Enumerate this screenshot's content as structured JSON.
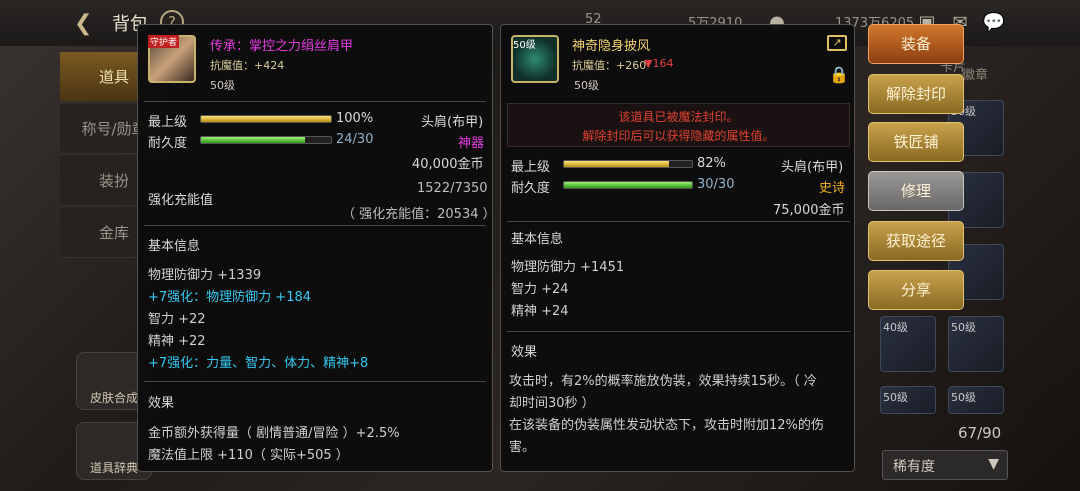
{
  "header": {
    "title": "背包",
    "currencies": [
      "52",
      "5万2910",
      "1373万6205"
    ]
  },
  "left_tabs": [
    "道具",
    "称号/勋章",
    "装扮",
    "金库"
  ],
  "left_buttons": [
    "皮肤合成",
    "道具辞典"
  ],
  "item1": {
    "badge": "守护者",
    "name": "传承：掌控之力绢丝肩甲",
    "resist": "抗魔值：+424",
    "level": "50级",
    "max_level_label": "最上级",
    "max_level_pct": "100%",
    "max_level_fill": 1.0,
    "durability_label": "耐久度",
    "durability": "24/30",
    "durability_fill": 0.8,
    "slot": "头肩(布甲)",
    "grade": "神器",
    "price": "40,000金币",
    "strength_label": "强化充能值",
    "strength_value": "1522/7350",
    "strength_sub": "（ 强化充能值：20534 ）",
    "basic_title": "基本信息",
    "stats": [
      "物理防御力 +1339",
      "+7强化：物理防御力 +184",
      "智力 +22",
      "精神 +22",
      "+7强化：力量、智力、体力、精神+8"
    ],
    "effect_title": "效果",
    "effects": [
      "金币额外获得量（ 剧情普通/冒险 ）+2.5%",
      "魔法值上限 +110（ 实际+505 ）"
    ]
  },
  "item2": {
    "icon_level": "50级",
    "name": "神奇隐身披风",
    "resist": "抗魔值：+260",
    "resist_down": "▼164",
    "level": "50级",
    "notice1": "该道具已被魔法封印。",
    "notice2": "解除封印后可以获得隐藏的属性值。",
    "max_level_label": "最上级",
    "max_level_pct": "82%",
    "max_level_fill": 0.82,
    "durability_label": "耐久度",
    "durability": "30/30",
    "durability_fill": 1.0,
    "slot": "头肩(布甲)",
    "grade": "史诗",
    "price": "75,000金币",
    "basic_title": "基本信息",
    "stats": [
      "物理防御力 +1451",
      "智力 +24",
      "精神 +24"
    ],
    "effect_title": "效果",
    "effect_lines": [
      "攻击时，有2%的概率施放伪装，效果持续15秒。（ 冷",
      "却时间30秒 ）",
      "在该装备的伪装属性发动状态下，攻击时附加12%的伤",
      "害。"
    ]
  },
  "actions": [
    "装备",
    "解除封印",
    "铁匠铺",
    "修理",
    "获取途径",
    "分享"
  ],
  "right": {
    "tab_labels": [
      "卡片",
      "徽章"
    ],
    "count": "67/90",
    "sort": "稀有度",
    "slot_levels": [
      "50级",
      "40级",
      "50级",
      "50级",
      "50级"
    ]
  },
  "colors": {
    "item1_name": "#e23be0",
    "item2_name": "#f0d070",
    "grade1": "#e23be0",
    "grade2": "#f0b020",
    "notice": "#e04030",
    "cyan": "#35c8f0"
  }
}
